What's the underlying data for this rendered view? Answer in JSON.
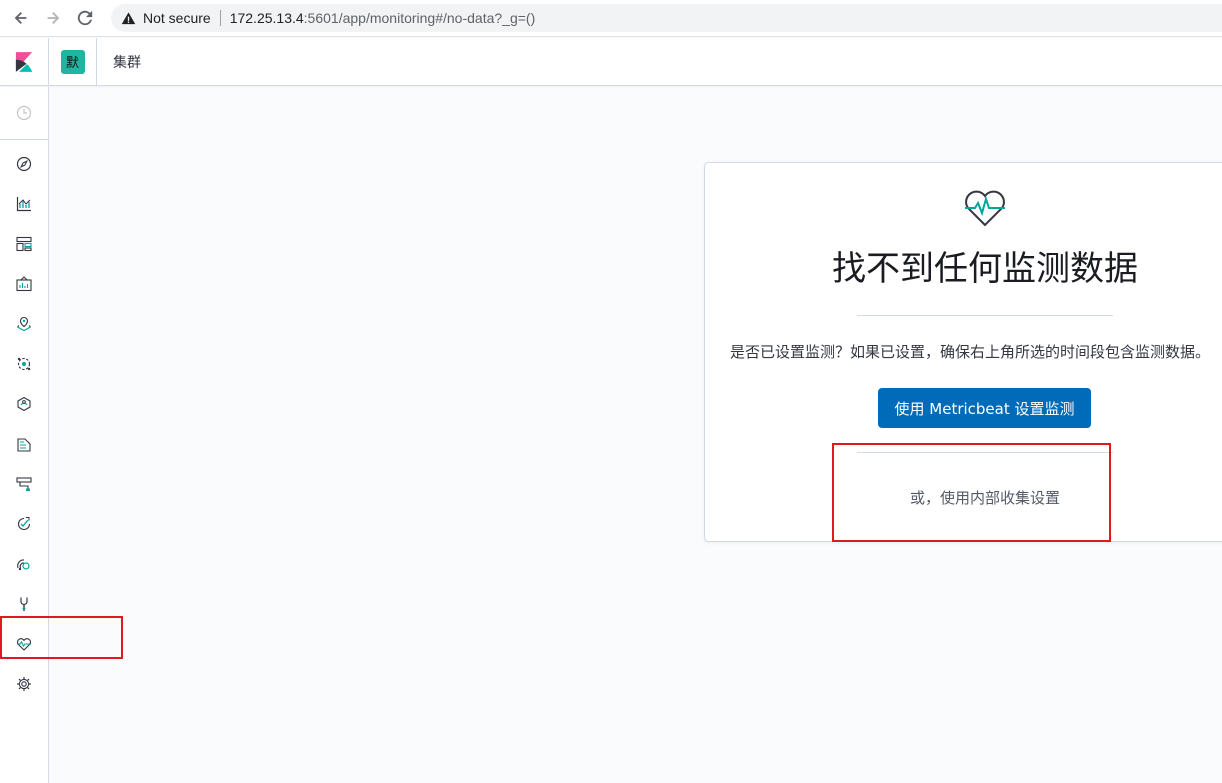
{
  "browser": {
    "security_label": "Not secure",
    "url_host": "172.25.13.4",
    "url_rest": ":5601/app/monitoring#/no-data?_g=()"
  },
  "header": {
    "space_initial": "默",
    "breadcrumb": "集群"
  },
  "nav": {
    "items": [
      {
        "icon": "clock-icon"
      },
      {
        "icon": "compass-icon"
      },
      {
        "icon": "visualize-icon"
      },
      {
        "icon": "dashboard-icon"
      },
      {
        "icon": "canvas-icon"
      },
      {
        "icon": "maps-icon"
      },
      {
        "icon": "ml-icon"
      },
      {
        "icon": "infrastructure-icon"
      },
      {
        "icon": "logs-icon"
      },
      {
        "icon": "apm-icon"
      },
      {
        "icon": "uptime-icon"
      },
      {
        "icon": "siem-icon"
      },
      {
        "icon": "devtools-icon"
      },
      {
        "icon": "monitoring-icon"
      },
      {
        "icon": "management-icon"
      }
    ]
  },
  "panel": {
    "icon": "heartbeat-monitoring-icon",
    "title": "找不到任何监测数据",
    "description": "是否已设置监测？如果已设置，确保右上角所选的时间段包含监测数据。",
    "primary_button": "使用 Metricbeat 设置监测",
    "alt_link": "或，使用内部收集设置"
  },
  "colors": {
    "primary": "#006bb8",
    "space_avatar": "#20b5a0",
    "annotation": "#e0191b"
  }
}
